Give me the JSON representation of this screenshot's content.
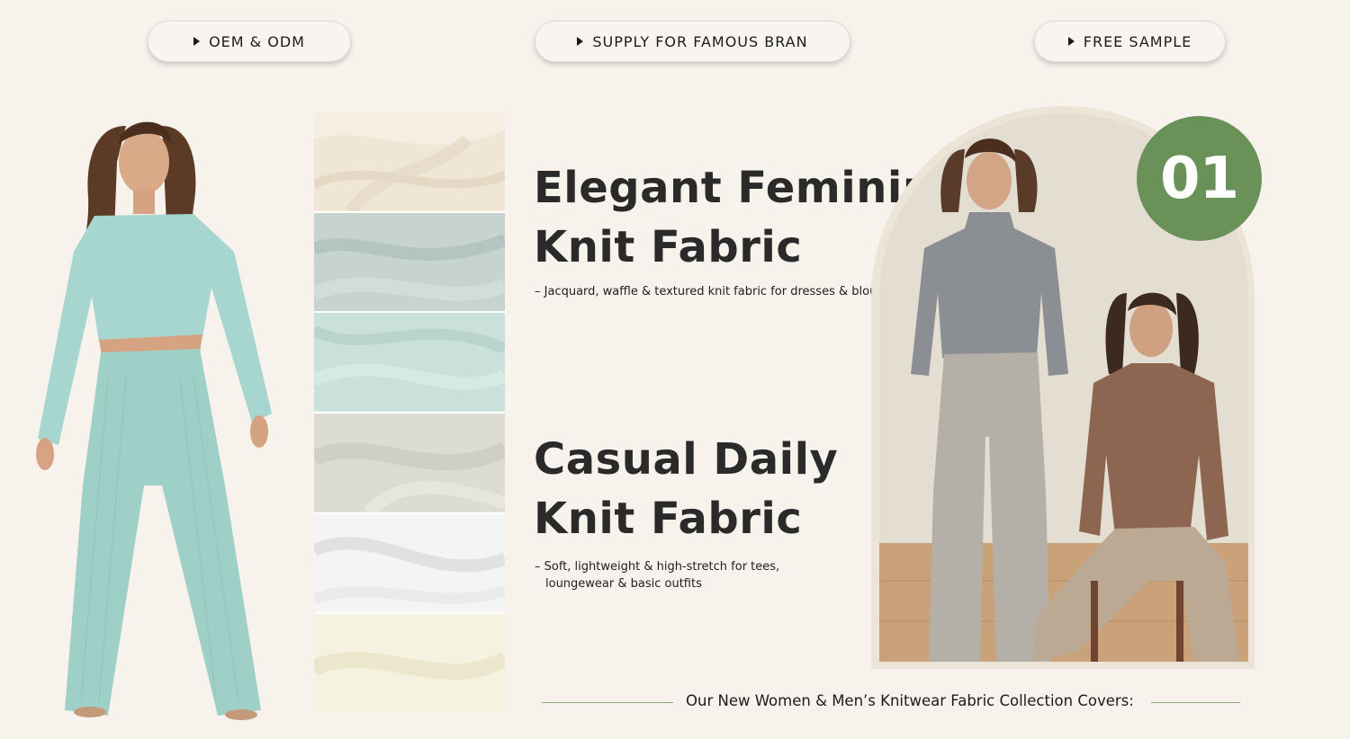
{
  "top_buttons": [
    {
      "label": "OEM & ODM"
    },
    {
      "label": "SUPPLY FOR FAMOUS BRAN"
    },
    {
      "label": "FREE SAMPLE"
    }
  ],
  "section_1": {
    "title_line_1": "Elegant Feminine",
    "title_line_2": "Knit Fabric",
    "description": "– Jacquard, waffle & textured knit fabric for dresses & blouses"
  },
  "section_2": {
    "title_line_1": "Casual Daily",
    "title_line_2": "Knit Fabric",
    "description_line_1": "– Soft, lightweight & high-stretch for tees,",
    "description_line_2": "loungewear & basic outfits"
  },
  "badge": {
    "number": "01",
    "color": "#6a9157"
  },
  "caption": "Our New Women & Men’s Knitwear Fabric Collection Covers:",
  "colors": {
    "background": "#f7f3ec",
    "accent_green": "#6a9157",
    "heading_text": "#2a2a2a"
  },
  "swatches": [
    {
      "name": "cream-rib-knit",
      "color": "#efe6d6"
    },
    {
      "name": "sage-waffle-knit",
      "color": "#c6d3cf"
    },
    {
      "name": "mint-rib-knit",
      "color": "#c9e1da"
    },
    {
      "name": "greige-jersey",
      "color": "#dcdcd3"
    },
    {
      "name": "white-rib-knit",
      "color": "#f4f4f4"
    },
    {
      "name": "ivory-jersey",
      "color": "#f5f2df"
    }
  ]
}
